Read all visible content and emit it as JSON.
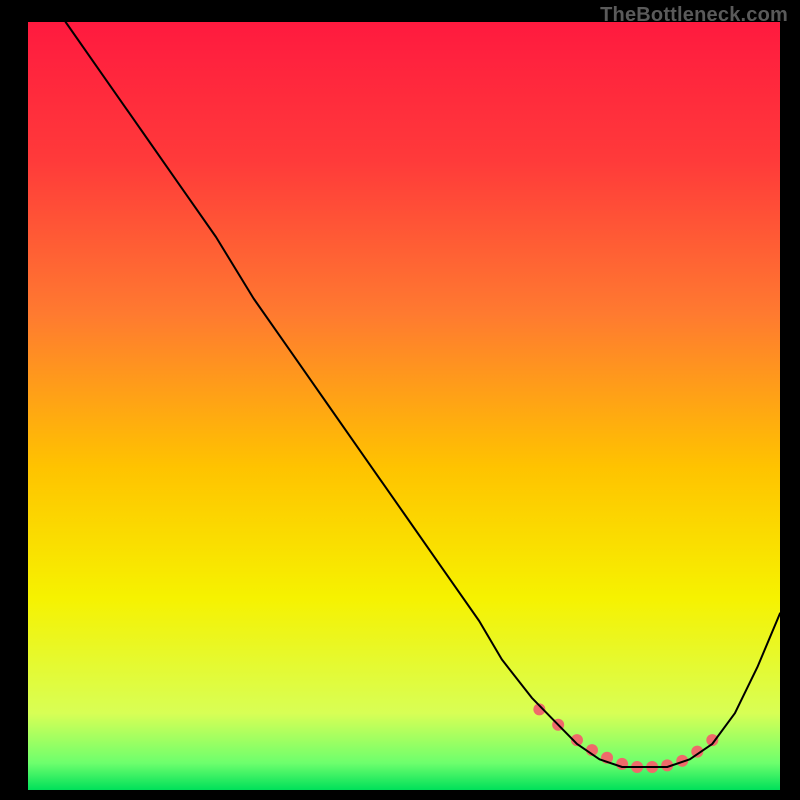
{
  "watermark": "TheBottleneck.com",
  "chart_data": {
    "type": "line",
    "title": "",
    "xlabel": "",
    "ylabel": "",
    "xlim": [
      0,
      100
    ],
    "ylim": [
      0,
      100
    ],
    "background": {
      "type": "vertical-gradient",
      "stops": [
        {
          "offset": 0.0,
          "color": "#ff1a3f"
        },
        {
          "offset": 0.18,
          "color": "#ff3a3a"
        },
        {
          "offset": 0.38,
          "color": "#ff7a30"
        },
        {
          "offset": 0.58,
          "color": "#ffc300"
        },
        {
          "offset": 0.75,
          "color": "#f6f200"
        },
        {
          "offset": 0.9,
          "color": "#d8ff55"
        },
        {
          "offset": 0.965,
          "color": "#6dff6d"
        },
        {
          "offset": 1.0,
          "color": "#00e05a"
        }
      ]
    },
    "series": [
      {
        "name": "bottleneck-curve",
        "color": "#000000",
        "stroke_width": 2,
        "x": [
          5,
          10,
          15,
          20,
          25,
          30,
          35,
          40,
          45,
          50,
          55,
          60,
          63,
          67,
          70,
          73,
          76,
          79,
          82,
          85,
          88,
          91,
          94,
          97,
          100
        ],
        "y": [
          100,
          93,
          86,
          79,
          72,
          64,
          57,
          50,
          43,
          36,
          29,
          22,
          17,
          12,
          9,
          6,
          4,
          3,
          3,
          3,
          4,
          6,
          10,
          16,
          23
        ]
      }
    ],
    "highlight": {
      "name": "optimal-zone",
      "color": "#ef6a6a",
      "radius": 6,
      "points_x": [
        68,
        70.5,
        73,
        75,
        77,
        79,
        81,
        83,
        85,
        87,
        89,
        91
      ],
      "points_y": [
        10.5,
        8.5,
        6.5,
        5.2,
        4.2,
        3.4,
        3.0,
        3.0,
        3.2,
        3.8,
        5.0,
        6.5
      ]
    }
  }
}
